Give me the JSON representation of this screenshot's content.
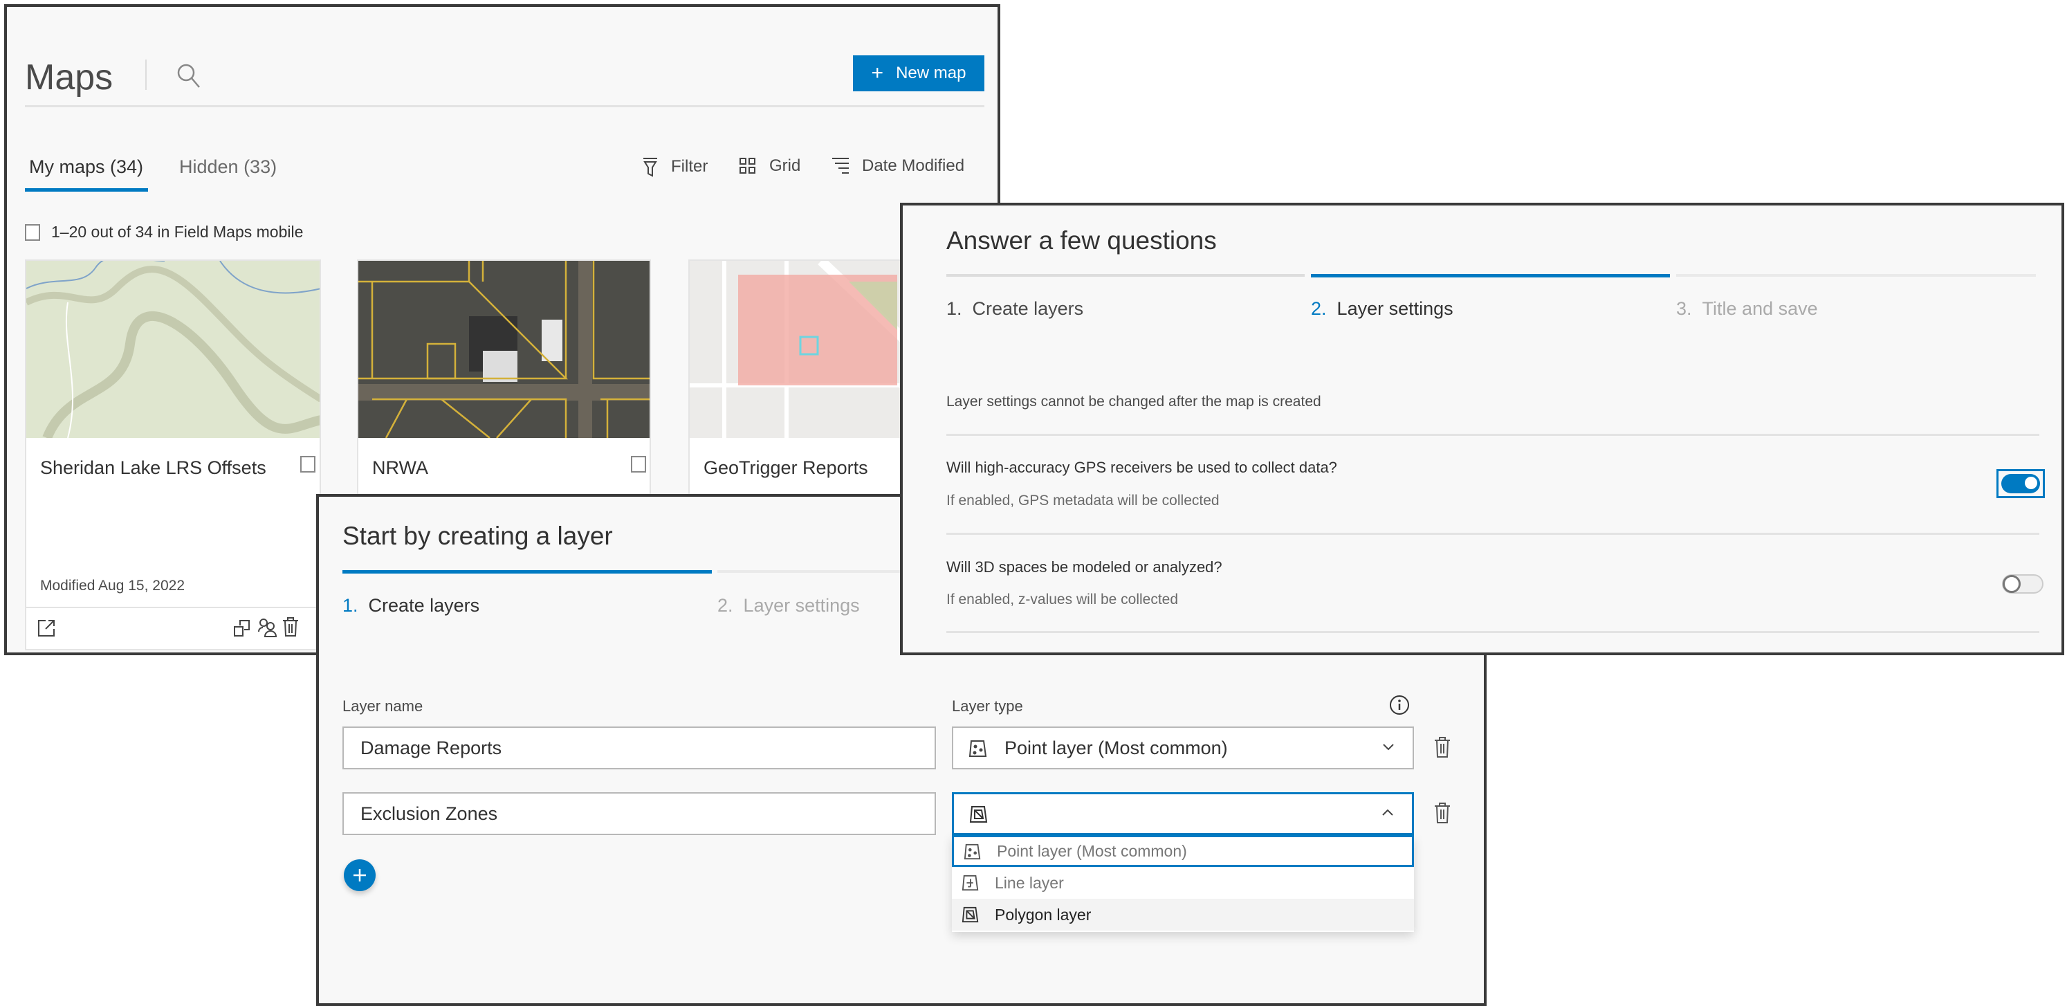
{
  "maps_panel": {
    "title": "Maps",
    "new_map_label": "New map",
    "tabs": [
      {
        "label": "My maps (34)",
        "active": true
      },
      {
        "label": "Hidden (33)",
        "active": false
      }
    ],
    "toolbar": {
      "filter": "Filter",
      "grid": "Grid",
      "sort": "Date Modified"
    },
    "select_all_label": "1–20 out of 34 in Field Maps mobile",
    "cards": [
      {
        "title": "Sheridan Lake LRS Offsets",
        "modified": "Modified Aug 15, 2022"
      },
      {
        "title": "NRWA"
      },
      {
        "title": "GeoTrigger Reports"
      }
    ]
  },
  "questions_panel": {
    "title": "Answer a few questions",
    "steps": [
      {
        "num": "1.",
        "label": "Create layers"
      },
      {
        "num": "2.",
        "label": "Layer settings"
      },
      {
        "num": "3.",
        "label": "Title and save"
      }
    ],
    "active_step": 2,
    "note": "Layer settings cannot be changed after the map is created",
    "questions": [
      {
        "question": "Will high-accuracy GPS receivers be used to collect data?",
        "hint": "If enabled, GPS metadata will be collected",
        "enabled": true
      },
      {
        "question": "Will 3D spaces be modeled or analyzed?",
        "hint": "If enabled, z-values will be collected",
        "enabled": false
      }
    ]
  },
  "layer_panel": {
    "title": "Start by creating a layer",
    "steps": [
      {
        "num": "1.",
        "label": "Create layers"
      },
      {
        "num": "2.",
        "label": "Layer settings"
      }
    ],
    "active_step": 1,
    "col_name": "Layer name",
    "col_type": "Layer type",
    "rows": [
      {
        "name": "Damage Reports",
        "type": "Point layer (Most common)",
        "type_icon": "point-layer-icon"
      },
      {
        "name": "Exclusion Zones",
        "type": "",
        "type_icon": "polygon-layer-icon"
      }
    ],
    "dropdown_options": [
      {
        "label": "Point layer (Most common)",
        "icon": "point-layer-icon",
        "focused": true
      },
      {
        "label": "Line layer",
        "icon": "line-layer-icon"
      },
      {
        "label": "Polygon layer",
        "icon": "polygon-layer-icon",
        "selected": true
      }
    ]
  },
  "colors": {
    "accent": "#007ac2",
    "border": "#3a3a3a",
    "background": "#f8f8f8"
  }
}
